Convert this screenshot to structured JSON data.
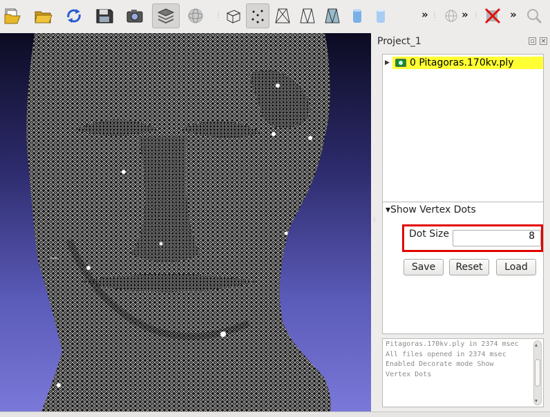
{
  "toolbar": {
    "icons": [
      "open-project-icon",
      "open-mesh-icon",
      "reload-icon",
      "save-icon",
      "snapshot-icon",
      "layers-icon",
      "wireframe-sphere-icon",
      "bbox-icon",
      "points-icon",
      "wire-icon",
      "hidden-lines-icon",
      "flat-lines-icon",
      "flat-icon",
      "smooth-icon",
      "globe-icon",
      "delete-icon",
      "search-icon"
    ],
    "chevron": "»"
  },
  "project": {
    "title": "Project_1"
  },
  "layers": [
    {
      "index": "0",
      "name": "Pitagoras.170kv.ply"
    }
  ],
  "decorator": {
    "title": "Show Vertex Dots",
    "dot_size_label": "Dot Size",
    "dot_size_value": "8",
    "save_label": "Save",
    "reset_label": "Reset",
    "load_label": "Load",
    "highlight_color": "#e30000"
  },
  "log": {
    "text": "Pitagoras.170kv.ply in 2374 msec\nAll files opened in 2374 msec\nEnabled Decorate mode Show\nVertex Dots"
  },
  "colors": {
    "selected_layer": "#ffff33",
    "viewport_top": "#0c0b22",
    "viewport_bottom": "#7a78d8"
  }
}
